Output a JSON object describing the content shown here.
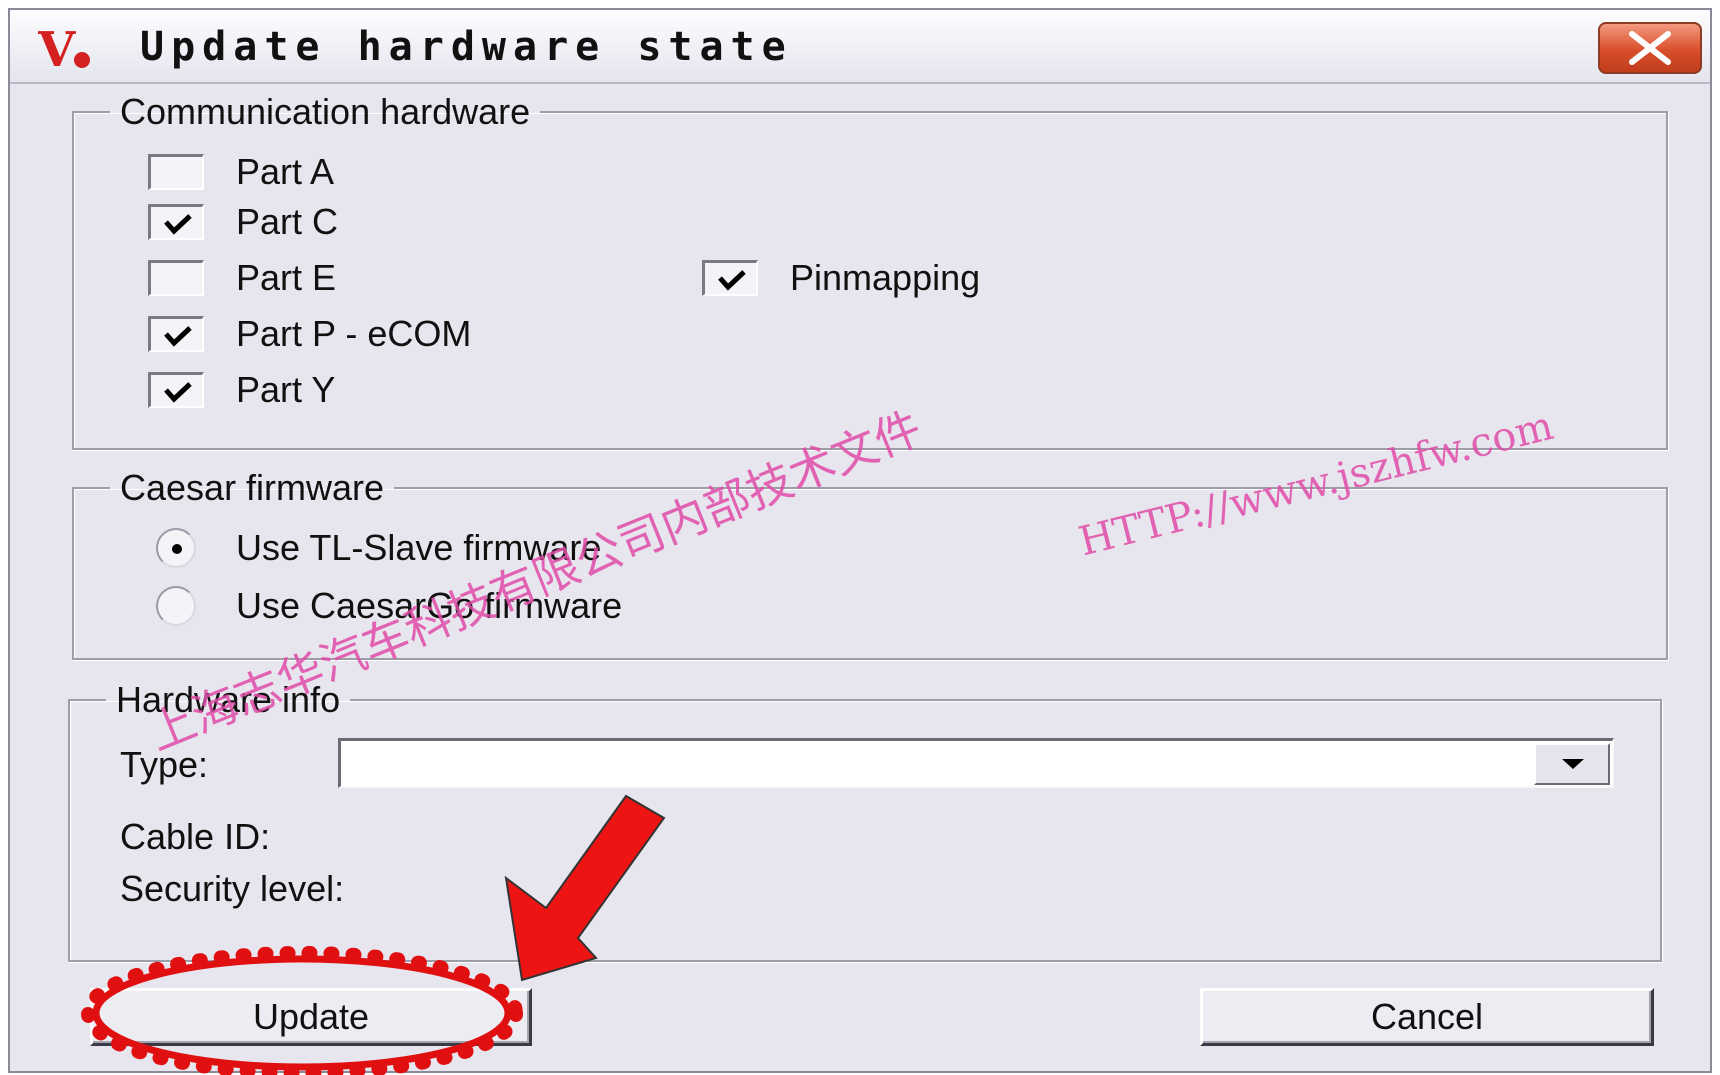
{
  "window": {
    "title": "Update hardware state",
    "logo_text": "V"
  },
  "communication_hardware": {
    "label": "Communication hardware",
    "items": [
      {
        "label": "Part A",
        "checked": false
      },
      {
        "label": "Part C",
        "checked": true
      },
      {
        "label": "Part E",
        "checked": false
      },
      {
        "label": "Part P - eCOM",
        "checked": true
      },
      {
        "label": "Part Y",
        "checked": true
      },
      {
        "label": "Pinmapping",
        "checked": true
      }
    ]
  },
  "caesar_firmware": {
    "label": "Caesar firmware",
    "options": [
      {
        "label": "Use TL-Slave firmware",
        "selected": true
      },
      {
        "label": "Use CaesarGo firmware",
        "selected": false
      }
    ]
  },
  "hardware_info": {
    "label": "Hardware info",
    "type_label": "Type:",
    "type_value": "",
    "cable_id_label": "Cable ID:",
    "security_level_label": "Security level:"
  },
  "buttons": {
    "update": "Update",
    "cancel": "Cancel"
  },
  "watermark": {
    "url": "HTTP://www.jszhfw.com",
    "chinese": "上海志华汽车科技有限公司内部技术文件"
  },
  "annotation_color": "#e01010"
}
